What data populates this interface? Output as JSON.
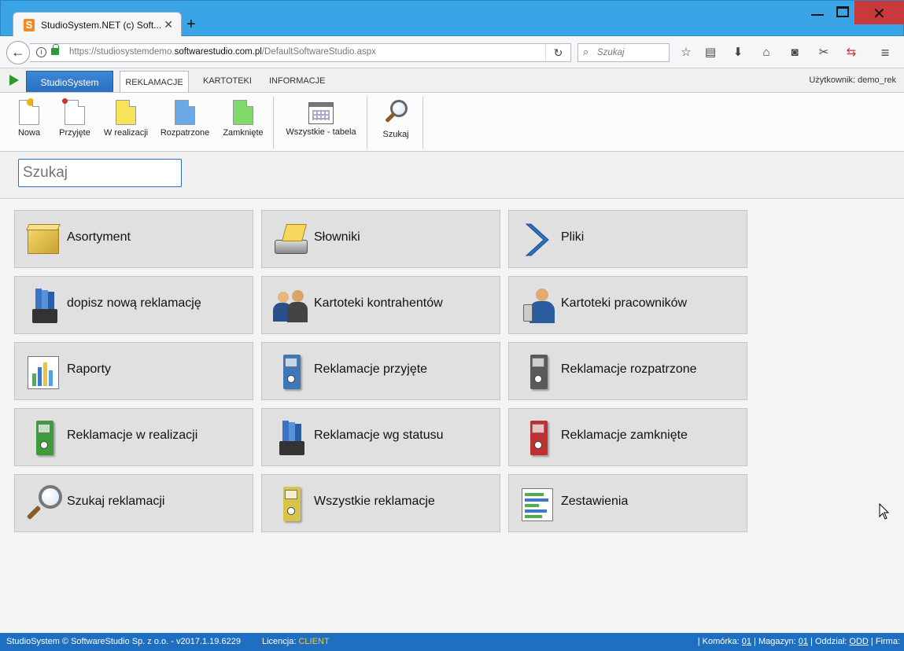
{
  "browser": {
    "tab_title": "StudioSystem.NET (c) Soft...",
    "tab_close": "✕",
    "new_tab": "+",
    "url_prefix": "https://studiosystemdemo.",
    "url_domain": "softwarestudio.com.pl",
    "url_path": "/DefaultSoftwareStudio.aspx",
    "search_placeholder": "Szukaj"
  },
  "app": {
    "main_tab": "StudioSystem",
    "tabs": [
      {
        "label": "REKLAMACJE",
        "active": true
      },
      {
        "label": "KARTOTEKI",
        "active": false
      },
      {
        "label": "INFORMACJE",
        "active": false
      }
    ],
    "user_label": "Użytkownik: demo_rek"
  },
  "ribbon": {
    "buttons": [
      {
        "label": "Nowa",
        "icon": "new-document-icon",
        "color": "#ffffff"
      },
      {
        "label": "Przyjęte",
        "icon": "received-document-icon",
        "color": "#ffffff"
      },
      {
        "label": "W realizacji",
        "icon": "in-progress-document-icon",
        "color": "#f7e35a"
      },
      {
        "label": "Rozpatrzone",
        "icon": "reviewed-document-icon",
        "color": "#6aa8e8"
      },
      {
        "label": "Zamknięte",
        "icon": "closed-document-icon",
        "color": "#7fd86a"
      },
      {
        "label": "Wszystkie - tabela",
        "icon": "calendar-table-icon"
      },
      {
        "label": "Szukaj",
        "icon": "search-icon"
      }
    ]
  },
  "search": {
    "placeholder": "Szukaj"
  },
  "tiles": [
    {
      "label": "Asortyment",
      "icon": "box-icon"
    },
    {
      "label": "Słowniki",
      "icon": "card-file-icon"
    },
    {
      "label": "Pliki",
      "icon": "chevron-right-icon"
    },
    {
      "label": "dopisz nową reklamację",
      "icon": "binders-icon"
    },
    {
      "label": "Kartoteki kontrahentów",
      "icon": "contractors-icon"
    },
    {
      "label": "Kartoteki pracowników",
      "icon": "employee-icon"
    },
    {
      "label": "Raporty",
      "icon": "report-chart-icon"
    },
    {
      "label": "Reklamacje przyjęte",
      "icon": "blue-binder-icon",
      "color": "#3e78b8"
    },
    {
      "label": "Reklamacje rozpatrzone",
      "icon": "gray-binder-icon",
      "color": "#5a5a5a"
    },
    {
      "label": "Reklamacje w realizacji",
      "icon": "green-binder-icon",
      "color": "#3f9a3a"
    },
    {
      "label": "Reklamacje wg statusu",
      "icon": "binders-icon"
    },
    {
      "label": "Reklamacje zamknięte",
      "icon": "red-binder-icon",
      "color": "#c03030"
    },
    {
      "label": "Szukaj reklamacji",
      "icon": "magnifier-icon"
    },
    {
      "label": "Wszystkie reklamacje",
      "icon": "yellow-binder-icon",
      "color": "#d9c44a"
    },
    {
      "label": "Zestawienia",
      "icon": "summary-chart-icon"
    }
  ],
  "status": {
    "left": "StudioSystem © SoftwareStudio Sp. z o.o. - v2017.1.19.6229",
    "license_label": "Licencja:",
    "license_value": "CLIENT",
    "komorka_label": "| Komórka:",
    "komorka_value": "01",
    "magazyn_label": "| Magazyn:",
    "magazyn_value": "01",
    "oddzial_label": "| Oddział:",
    "oddzial_value": "ODD",
    "firma_label": "| Firma:"
  }
}
